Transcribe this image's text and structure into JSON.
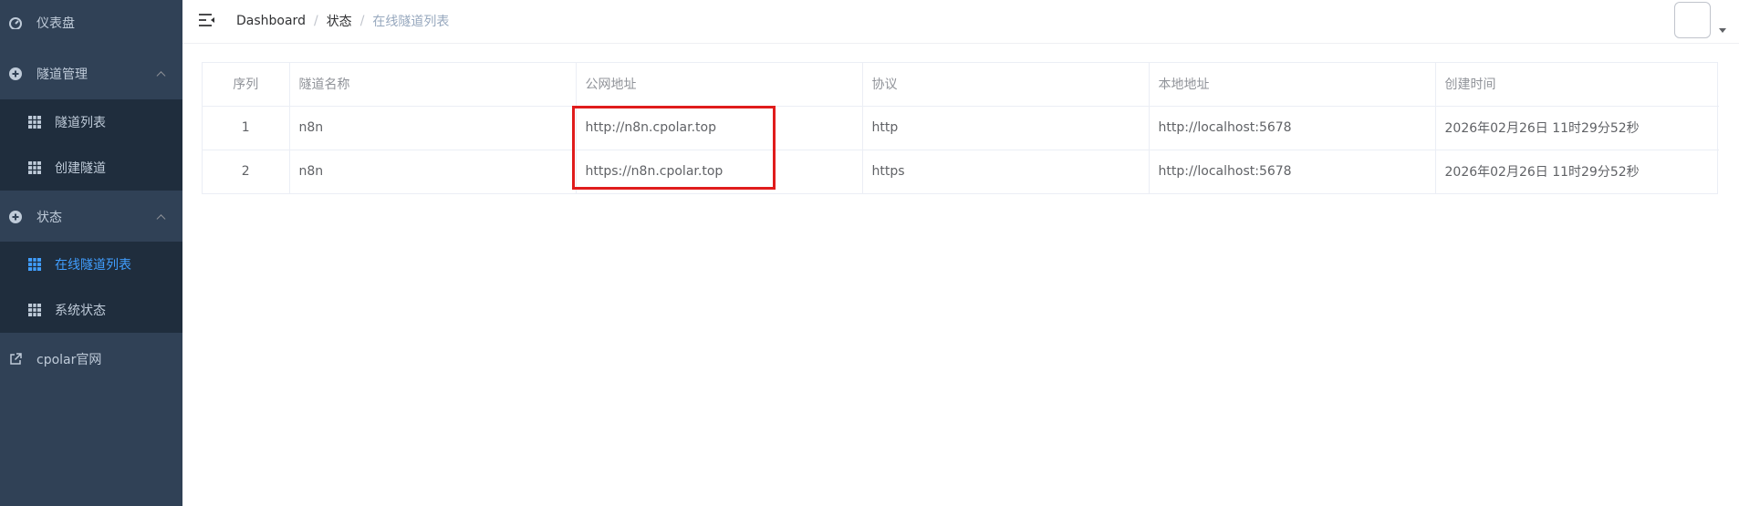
{
  "sidebar": {
    "dashboard": "仪表盘",
    "tunnel_mgmt": "隧道管理",
    "tunnel_list": "隧道列表",
    "create_tunnel": "创建隧道",
    "status": "状态",
    "online_tunnels": "在线隧道列表",
    "system_status": "系统状态",
    "official_site": "cpolar官网"
  },
  "breadcrumb": [
    "Dashboard",
    "状态",
    "在线隧道列表"
  ],
  "table": {
    "columns": [
      "序列",
      "隧道名称",
      "公网地址",
      "协议",
      "本地地址",
      "创建时间"
    ],
    "rows": [
      [
        "1",
        "n8n",
        "http://n8n.cpolar.top",
        "http",
        "http://localhost:5678",
        "2026年02月26日 11时29分52秒"
      ],
      [
        "2",
        "n8n",
        "https://n8n.cpolar.top",
        "https",
        "http://localhost:5678",
        "2026年02月26日 11时29分52秒"
      ]
    ]
  },
  "colors": {
    "sidebar_bg": "#304156",
    "submenu_bg": "#1f2d3d",
    "active": "#409eff",
    "highlight": "#e01c1c"
  }
}
